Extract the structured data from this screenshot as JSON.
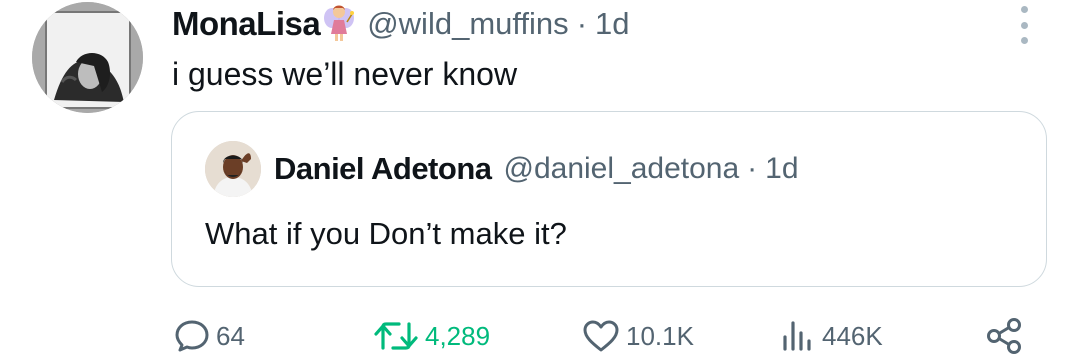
{
  "author": {
    "display_name": "MonaLisa",
    "emoji_icon": "fairy-emoji-icon",
    "handle": "@wild_muffins",
    "separator": "·",
    "time": "1d"
  },
  "tweet": {
    "text": "i guess we’ll never know"
  },
  "quoted_tweet": {
    "display_name": "Daniel Adetona",
    "handle": "@daniel_adetona",
    "separator": "·",
    "time": "1d",
    "text": "What if you Don’t make it?"
  },
  "actions": {
    "replies": "64",
    "retweets": "4,289",
    "likes": "10.1K",
    "views": "446K"
  },
  "colors": {
    "text_primary": "#0f1419",
    "text_secondary": "#536471",
    "retweet_active": "#00ba7c",
    "border": "#cfd9de"
  },
  "icons": [
    "kebab-menu-icon",
    "reply-icon",
    "retweet-icon",
    "like-icon",
    "views-icon",
    "share-icon"
  ]
}
